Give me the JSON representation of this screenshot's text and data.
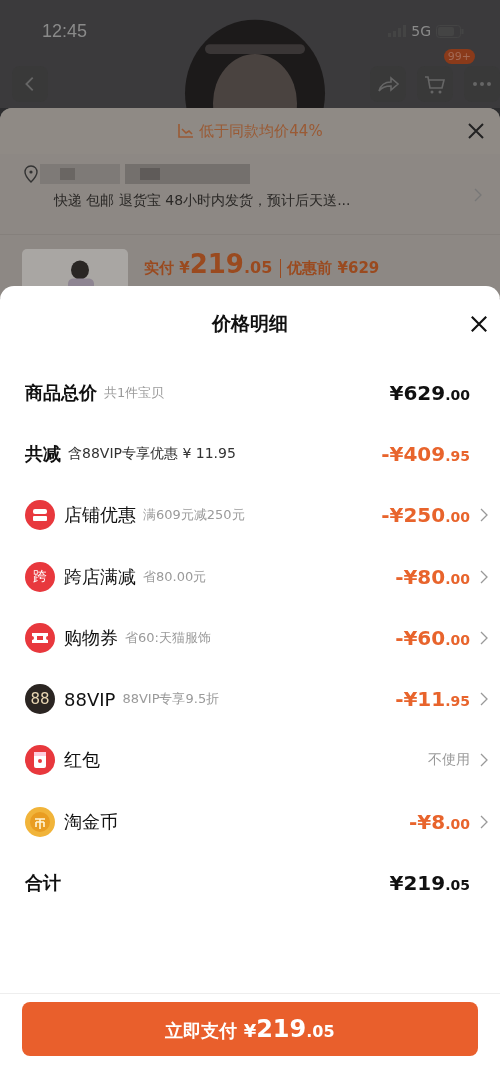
{
  "status_bar": {
    "time": "12:45",
    "network": "5G"
  },
  "header": {
    "cart_badge": "99+"
  },
  "background_sheet": {
    "banner": "低于同款均价44%",
    "delivery": "快递 包邮 退货宝 48小时内发货，预计后天送...",
    "paid_label": "实付 ¥",
    "paid_amount": "219",
    "paid_cents": ".05",
    "before_label": "优惠前 ¥629"
  },
  "sheet": {
    "title": "价格明细",
    "subtotal": {
      "label": "商品总价",
      "note": "共1件宝贝",
      "amount": "¥629",
      "cents": ".00"
    },
    "reduction": {
      "label": "共减",
      "note": "含88VIP专享优惠 ¥ 11.95",
      "amount": "-¥409",
      "cents": ".95"
    },
    "items": [
      {
        "kind": "shop",
        "label": "店铺优惠",
        "note": "满609元减250元",
        "amount": "-¥250",
        "cents": ".00"
      },
      {
        "kind": "cross",
        "badge": "跨",
        "label": "跨店满减",
        "note": "省80.00元",
        "amount": "-¥80",
        "cents": ".00"
      },
      {
        "kind": "coupon",
        "label": "购物券",
        "note": "省60:天猫服饰",
        "amount": "-¥60",
        "cents": ".00"
      },
      {
        "kind": "vip",
        "badge": "88",
        "label": "88VIP",
        "note": "88VIP专享9.5折",
        "amount": "-¥11",
        "cents": ".95"
      },
      {
        "kind": "redpacket",
        "label": "红包",
        "status": "不使用"
      },
      {
        "kind": "coin",
        "label": "淘金币",
        "amount": "-¥8",
        "cents": ".00"
      }
    ],
    "total": {
      "label": "合计",
      "amount": "¥219",
      "cents": ".05"
    },
    "pay_button": {
      "label": "立即支付 ¥",
      "amount": "219",
      "cents": ".05"
    }
  }
}
